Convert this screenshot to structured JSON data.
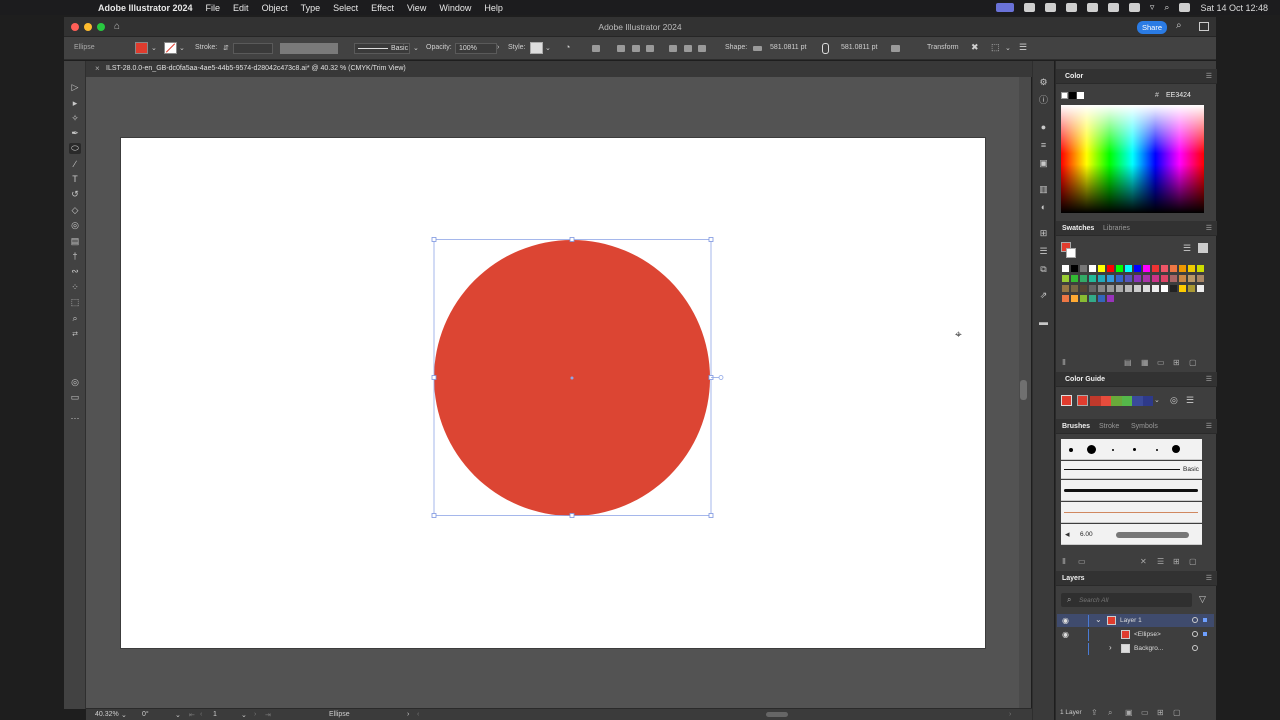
{
  "menubar": {
    "app_name": "Adobe Illustrator 2024",
    "items": [
      "File",
      "Edit",
      "Object",
      "Type",
      "Select",
      "Effect",
      "View",
      "Window",
      "Help"
    ],
    "datetime": "Sat 14 Oct  12:48"
  },
  "titlebar": {
    "title": "Adobe Illustrator 2024",
    "share_label": "Share"
  },
  "control_bar": {
    "selection_type": "Ellipse",
    "fill_color": "#E03C2E",
    "stroke_label": "Stroke:",
    "brush_label": "Basic",
    "opacity_label": "Opacity:",
    "opacity_value": "100%",
    "style_label": "Style:",
    "shape_label": "Shape:",
    "width_value": "581.0811 pt",
    "height_value": "581.0811 pt",
    "transform_label": "Transform"
  },
  "document": {
    "tab_title": "ILST-28.0.0-en_GB-dc0fa5aa-4ae5-44b5-9574-d28042c473c8.ai* @ 40.32 % (CMYK/Trim View)",
    "ellipse_color": "#DC4533"
  },
  "status_bar": {
    "zoom": "40.32%",
    "rotation": "0°",
    "artboard_number": "1",
    "current_tool": "Ellipse"
  },
  "panels": {
    "color": {
      "tab": "Color",
      "hex_value": "EE3424"
    },
    "swatches": {
      "tab_swatches": "Swatches",
      "tab_libraries": "Libraries"
    },
    "color_guide": {
      "tab": "Color Guide",
      "harmony_colors": [
        "#E03C2E",
        "#C0392B",
        "#E74C3C",
        "#6AAA3A",
        "#55B84A",
        "#3A4A9A",
        "#2E3A8A"
      ]
    },
    "brushes": {
      "tab_brushes": "Brushes",
      "tab_stroke": "Stroke",
      "tab_symbols": "Symbols",
      "basic_label": "Basic",
      "size_value": "6.00"
    },
    "layers": {
      "tab": "Layers",
      "search_placeholder": "Search All",
      "rows": [
        {
          "name": "Layer 1"
        },
        {
          "name": "<Ellipse>"
        },
        {
          "name": "Backgro..."
        }
      ],
      "footer": "1 Layer"
    }
  }
}
